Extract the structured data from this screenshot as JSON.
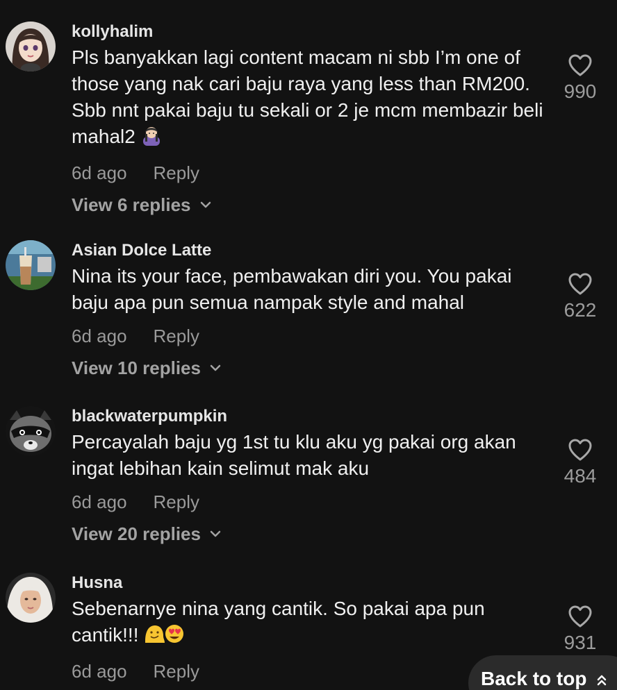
{
  "comments": [
    {
      "username": "kollyhalim",
      "text": "Pls banyakkan lagi content macam ni sbb I’m one of those yang nak cari baju raya yang less than RM200. Sbb nnt pakai baju tu sekali or 2 je mcm membazir beli mahal2",
      "emoji": "woman-gesturing-emoji",
      "time": "6d ago",
      "reply_label": "Reply",
      "view_replies": "View 6 replies",
      "likes": "990",
      "avatar_icon": "anime-girl-avatar"
    },
    {
      "username": "Asian Dolce Latte",
      "text": "Nina its your face, pembawakan diri you. You pakai baju apa pun semua nampak style and mahal",
      "time": "6d ago",
      "reply_label": "Reply",
      "view_replies": "View 10 replies",
      "likes": "622",
      "avatar_icon": "iced-latte-avatar"
    },
    {
      "username": "blackwaterpumpkin",
      "text": "Percayalah baju yg 1st tu klu aku yg pakai org akan ingat lebihan kain selimut mak aku",
      "time": "6d ago",
      "reply_label": "Reply",
      "view_replies": "View 20 replies",
      "likes": "484",
      "avatar_icon": "raccoon-avatar"
    },
    {
      "username": "Husna",
      "text": "Sebenarnye nina yang cantik. So pakai apa pun cantik!!!",
      "emoji": "melting-face-and-heart-eyes-emoji",
      "time": "6d ago",
      "reply_label": "Reply",
      "likes": "931",
      "avatar_icon": "hijab-woman-avatar"
    }
  ],
  "back_to_top": "Back to top",
  "colors": {
    "background": "#121212",
    "text": "#f0f0f0",
    "muted": "#9a9a9a",
    "button_bg": "#2b2b2b"
  }
}
